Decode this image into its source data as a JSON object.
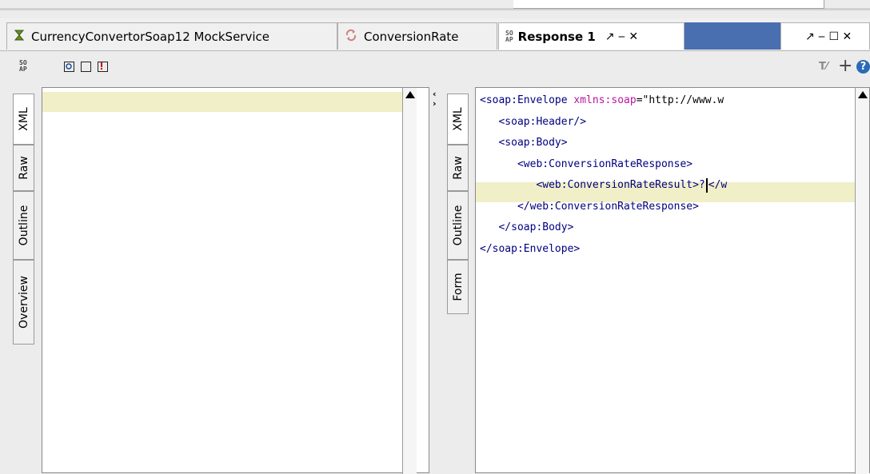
{
  "tabs": [
    {
      "label": "CurrencyConvertorSoap12 MockService",
      "icon": "mockservice-icon"
    },
    {
      "label": "ConversionRate",
      "icon": "mock-operation-icon"
    },
    {
      "label": "Response 1",
      "icon": "soap-icon",
      "active": true
    }
  ],
  "window_controls": {
    "active_tab": "↗ ‒ ✕",
    "right_area": "↗ ‒ ☐ ✕"
  },
  "toolbar": {
    "soap_label": "SO\nAP"
  },
  "left_panel": {
    "side_tabs": [
      "XML",
      "Raw",
      "Outline",
      "Overview"
    ],
    "active_tab": "XML"
  },
  "right_panel": {
    "side_tabs": [
      "XML",
      "Raw",
      "Outline",
      "Form"
    ],
    "active_tab": "XML"
  },
  "xml": {
    "line1_tag": "<soap:Envelope ",
    "line1_attr": "xmlns:soap",
    "line1_val": "=\"http://www.w",
    "line2": "   <soap:Header/>",
    "line3": "   <soap:Body>",
    "line4": "      <web:ConversionRateResponse>",
    "line5_a": "         <web:ConversionRateResult>?",
    "line5_b": "</w",
    "line6": "      </web:ConversionRateResponse>",
    "line7": "   </soap:Body>",
    "line8": "</soap:Envelope>"
  }
}
